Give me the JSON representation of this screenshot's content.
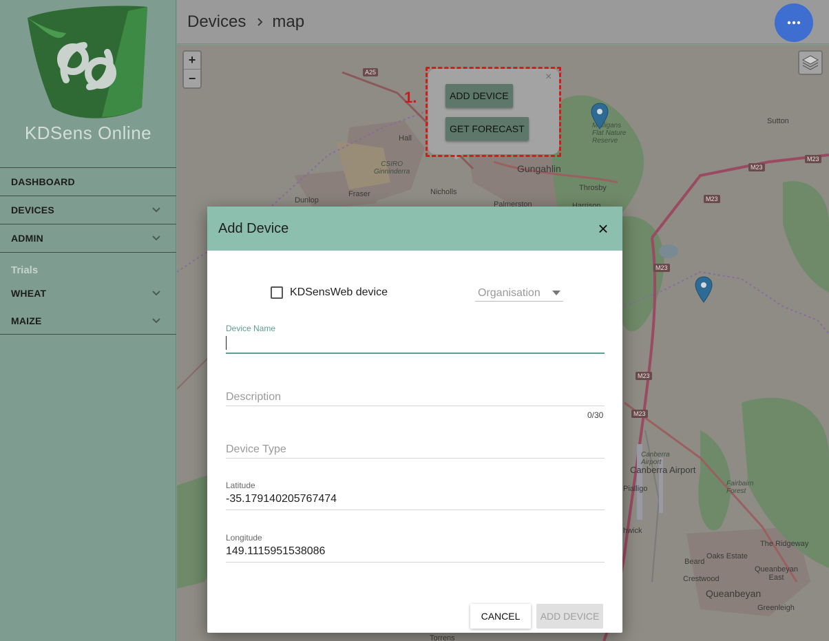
{
  "app": {
    "logo_text": "KDSens Online"
  },
  "sidebar": {
    "items": [
      {
        "label": "DASHBOARD"
      },
      {
        "label": "DEVICES"
      },
      {
        "label": "ADMIN"
      }
    ],
    "section_label": "Trials",
    "trials": [
      {
        "label": "WHEAT"
      },
      {
        "label": "MAIZE"
      }
    ]
  },
  "header": {
    "breadcrumb": [
      "Devices",
      "map"
    ],
    "menu_icon": "more-horizontal-icon"
  },
  "map": {
    "zoom_in": "+",
    "zoom_out": "−",
    "labels": {
      "a25": "A25",
      "hall": "Hall",
      "csiro": "CSIRO\nGinninderra",
      "gungahlin": "Gungahlin",
      "nicholls": "Nicholls",
      "dunlop": "Dunlop",
      "fraser": "Fraser",
      "palmerston": "Palmerston",
      "throsby": "Throsby",
      "harrison": "Harrison",
      "sutton": "Sutton",
      "mulligans": "Mulligans\nFlat Nature\nReserve",
      "m23a": "M23",
      "m23b": "M23",
      "m23c": "M23",
      "m23d": "M23",
      "m23e": "M23",
      "m23f": "M23",
      "canberra_airport_it": "Canberra\nAirport",
      "canberra_airport": "Canberra Airport",
      "pialligo": "Pialligo",
      "fairbairn": "Fairbairn\nForest",
      "hwick": "hwick",
      "oaks_estate": "Oaks Estate",
      "the_ridgeway": "The Ridgeway",
      "beard": "Beard",
      "queanbeyan_east": "Queanbeyan\nEast",
      "crestwood": "Crestwood",
      "queanbeyan": "Queanbeyan",
      "greenleigh": "Greenleigh",
      "torrens": "Torrens"
    },
    "popup": {
      "step_label": "1.",
      "close": "×",
      "add_device_label": "ADD DEVICE",
      "get_forecast_label": "GET FORECAST"
    }
  },
  "dialog": {
    "title": "Add Device",
    "close": "×",
    "kdsensweb_label": "KDSensWeb device",
    "organisation_placeholder": "Organisation",
    "device_name_label": "Device Name",
    "device_name_value": "",
    "description_placeholder": "Description",
    "description_counter": "0/30",
    "device_type_placeholder": "Device Type",
    "latitude_label": "Latitude",
    "latitude_value": "-35.179140205767474",
    "longitude_label": "Longitude",
    "longitude_value": "149.1115951538086",
    "cancel_label": "CANCEL",
    "add_label": "ADD DEVICE"
  },
  "colors": {
    "sidebar": "#7f9c90",
    "dialog_header": "#8cbfae",
    "fab": "#3e6ed0",
    "focus": "#5f9e88",
    "annotation": "#d11c1c"
  }
}
